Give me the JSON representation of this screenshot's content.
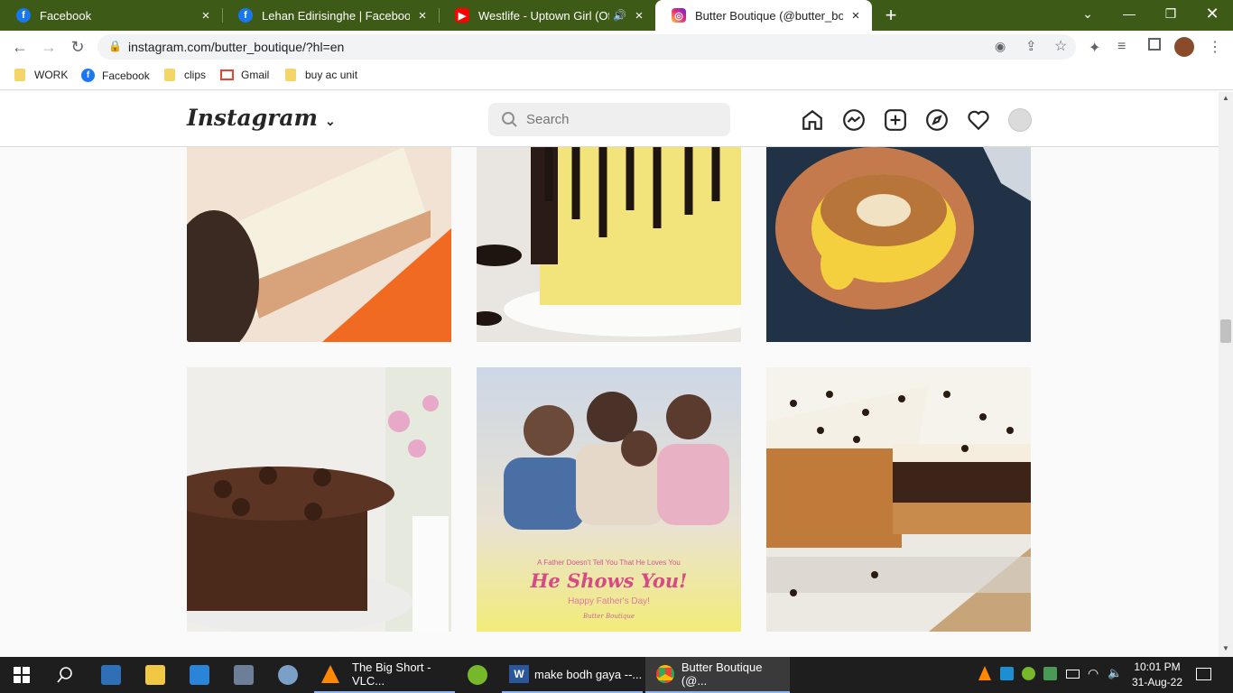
{
  "tabs": [
    {
      "title": "Facebook",
      "close": "×"
    },
    {
      "title": "Lehan Edirisinghe | Facebook",
      "close": "×"
    },
    {
      "title": "Westlife - Uptown Girl (Offici",
      "close": "×"
    },
    {
      "title": "Butter Boutique (@butter_boutiq",
      "close": "×"
    }
  ],
  "new_tab": "+",
  "url": "instagram.com/butter_boutique/?hl=en",
  "bookmarks": [
    {
      "label": "WORK"
    },
    {
      "label": "Facebook"
    },
    {
      "label": "clips"
    },
    {
      "label": "Gmail"
    },
    {
      "label": "buy ac unit"
    }
  ],
  "instagram": {
    "logo": "Instagram",
    "search_placeholder": "Search",
    "post_text": {
      "line1": "A Father Doesn't Tell You That He Loves You",
      "line2": "He Shows You!",
      "line3": "Happy Father's Day!",
      "brand": "Butter Boutique"
    }
  },
  "taskbar": {
    "items": [
      {
        "label": "The Big Short - VLC..."
      },
      {
        "label": "make bodh gaya --..."
      },
      {
        "label": "Butter Boutique (@..."
      }
    ],
    "time": "10:01 PM",
    "date": "31-Aug-22"
  },
  "colors": {
    "tabstrip": "#3d5a16",
    "taskbar": "#1e1e1e",
    "ig_bg": "#fafafa"
  }
}
